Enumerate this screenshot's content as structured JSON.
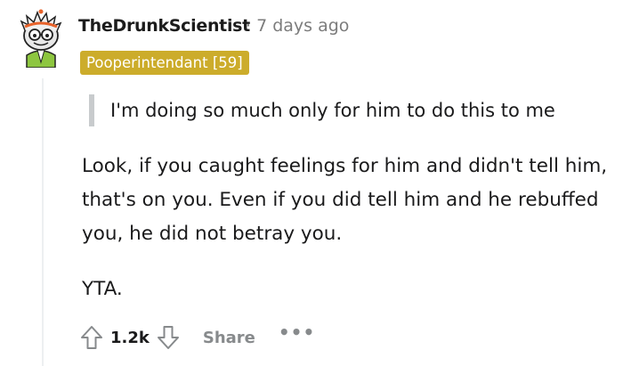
{
  "comment": {
    "author": "TheDrunkScientist",
    "separator": "·",
    "timestamp": "7 days ago",
    "flair": "Pooperintendant [59]",
    "quote": "I'm doing so much only for him to do this to me",
    "body": "Look, if you caught feelings for him and didn't tell him, that's on you. Even if you did tell him and he rebuffed you, he did not betray you.",
    "verdict": "YTA.",
    "score": "1.2k",
    "share_label": "Share",
    "more_label": "•••"
  },
  "colors": {
    "flair_bg": "#ccac2b",
    "meta_text": "#7c7c7c",
    "action_text": "#878a8c",
    "thread_line": "#edeff1"
  },
  "icons": {
    "avatar": "scientist-snoo-avatar-icon",
    "upvote": "arrow-up-icon",
    "downvote": "arrow-down-icon",
    "more": "ellipsis-icon"
  }
}
